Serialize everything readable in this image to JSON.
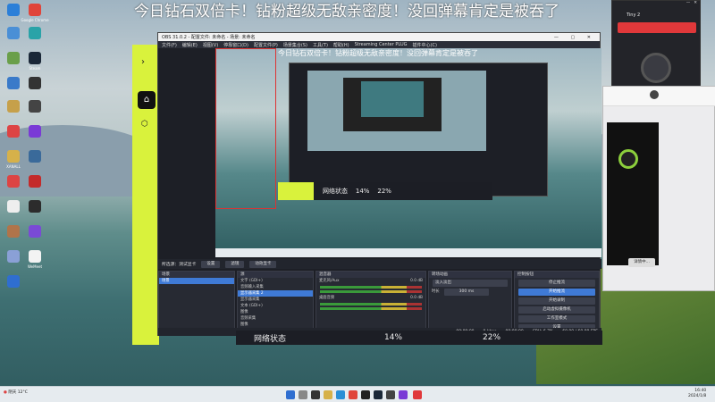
{
  "banner": {
    "text": "今日钻石双倍卡！钻粉超级无敌亲密度！没回弹幕肯定是被吞了"
  },
  "desktop_icons": [
    {
      "label": "",
      "color": "#2b7fd8"
    },
    {
      "label": "Google Chrome",
      "color": "#e0443a"
    },
    {
      "label": "",
      "color": "#4a8fd6"
    },
    {
      "label": "",
      "color": "#2aa3a8"
    },
    {
      "label": "",
      "color": "#6a9f4a"
    },
    {
      "label": "Steam",
      "color": "#1b2838"
    },
    {
      "label": "",
      "color": "#3a7ac9"
    },
    {
      "label": "",
      "color": "#333"
    },
    {
      "label": "",
      "color": "#c6a04a"
    },
    {
      "label": "",
      "color": "#444"
    },
    {
      "label": "",
      "color": "#d44"
    },
    {
      "label": "",
      "color": "#7a3ad6"
    },
    {
      "label": "XANALL",
      "color": "#d6b14a"
    },
    {
      "label": "",
      "color": "#3a6a9a"
    },
    {
      "label": "",
      "color": "#d44"
    },
    {
      "label": "",
      "color": "#c42a2a"
    },
    {
      "label": "",
      "color": "#eee"
    },
    {
      "label": "",
      "color": "#2c2c2c"
    },
    {
      "label": "",
      "color": "#b0744a"
    },
    {
      "label": "",
      "color": "#7a4ad6"
    },
    {
      "label": "",
      "color": "#8aa0d6"
    },
    {
      "label": "WeMeet",
      "color": "#f3f3f3"
    },
    {
      "label": "",
      "color": "#2f6ed0"
    }
  ],
  "obs": {
    "title": "OBS 31.0.2 - 配置文件: 未命名 - 场景: 未命名",
    "menu": [
      "文件(F)",
      "编辑(E)",
      "视图(V)",
      "停靠窗口(D)",
      "配置文件(P)",
      "场景集合(S)",
      "工具(T)",
      "帮助(H)",
      "Streaming Center PLUG",
      "插件中心(C)"
    ],
    "preview_banner": "今日钻石双倍卡！钻粉超级无敌亲密度！没回弹幕肯定是被吞了",
    "source_toolbar": [
      "所选源：测试显卡",
      "设置",
      "滤镜",
      "动效显卡"
    ],
    "panels": {
      "scenes": {
        "title": "场景",
        "items": [
          "场景"
        ]
      },
      "sources": {
        "title": "源",
        "items": [
          "文字 (GDI+)",
          "音频输入采集",
          "显示器采集 2",
          "显示器采集",
          "文本 (GDI+)",
          "图像",
          "音频采集",
          "图像"
        ]
      },
      "mixer": {
        "title": "混音器",
        "channels": [
          {
            "name": "麦克风/Aux",
            "db": "0.0 dB"
          },
          {
            "name": "桌面音频",
            "db": "0.0 dB"
          }
        ]
      },
      "transitions": {
        "title": "转场动画",
        "type": "淡入淡出",
        "duration_label": "时长",
        "duration": "300 ms"
      },
      "controls": {
        "title": "控制按钮",
        "buttons": [
          "停止推流",
          "开始推流",
          "开始录制",
          "启动虚拟摄像机",
          "工作室模式",
          "设置",
          "退出"
        ]
      }
    },
    "status": [
      "00:00:00",
      "0 kbps",
      "00:00:00",
      "CPU: 6.7%",
      "60.00 / 60.00 FPS"
    ]
  },
  "netstat": {
    "label": "网络状态",
    "v1": "14%",
    "v2": "22%"
  },
  "right_panel": {
    "title": "Tiny 2",
    "sub": "",
    "btn": "详情中..."
  },
  "taskbar": {
    "weather": "阴天 12°C",
    "time": "16:40",
    "date": "2024/1/8"
  }
}
